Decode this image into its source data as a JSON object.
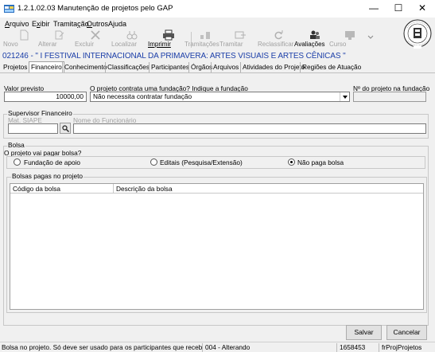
{
  "window": {
    "title": "1.2.1.02.03 Manutenção de projetos pelo GAP",
    "minimize": "—",
    "maximize": "☐",
    "close": "✕"
  },
  "menu": {
    "items": [
      {
        "u": "A",
        "rest": "rquivo"
      },
      {
        "u": "",
        "pre": "E",
        "u2": "x",
        "rest": "ibir"
      },
      {
        "u": "",
        "pre": "Tramita",
        "u2": "ç",
        "rest": "ão"
      },
      {
        "u": "O",
        "rest": "utros"
      },
      {
        "u": "",
        "pre": "A",
        "u2": "j",
        "rest": "uda"
      }
    ]
  },
  "toolbar": {
    "buttons": [
      {
        "label": "Novo",
        "icon": "new-doc-icon",
        "enabled": false
      },
      {
        "label": "Alterar",
        "icon": "edit-doc-icon",
        "enabled": false
      },
      {
        "label": "Excluir",
        "icon": "delete-x-icon",
        "enabled": false
      },
      {
        "label": "Localizar",
        "icon": "binoculars-icon",
        "enabled": false
      },
      {
        "label": "Imprimir",
        "icon": "printer-icon",
        "enabled": true
      },
      {
        "label": "Tramitações",
        "icon": "workflow-icon",
        "enabled": false
      },
      {
        "label": "Tramitar",
        "icon": "send-icon",
        "enabled": false
      },
      {
        "label": "Reclassificar",
        "icon": "refresh-icon",
        "enabled": false
      },
      {
        "label": "Avaliações",
        "icon": "people-icon",
        "enabled": true
      },
      {
        "label": "Curso",
        "icon": "monitor-icon",
        "enabled": false
      }
    ]
  },
  "project_title": "021246 - \" I FESTIVAL INTERNACIONAL DA PRIMAVERA: ARTES VISUAIS E ARTES CÊNICAS \"",
  "tabs": [
    "Projetos",
    "Financeiro",
    "Conhecimento",
    "Classificações",
    "Participantes",
    "Órgãos",
    "Arquivos",
    "Atividades do Projeto",
    "Regiões de Atuação"
  ],
  "active_tab": "Financeiro",
  "financeiro": {
    "valor_previsto_label": "Valor previsto",
    "valor_previsto": "10000,00",
    "fundacao_label": "O projeto contrata uma fundação? Indique a fundação",
    "fundacao_value": "Não necessita contratar fundação",
    "n_projeto_fundacao_label": "Nº do projeto na fundação",
    "n_projeto_fundacao_value": "",
    "supervisor_group": "Supervisor Financeiro",
    "mat_siape_label": "Mat. SIAPE",
    "mat_siape_value": "",
    "nome_funcionario_label": "Nome do Funcionário",
    "nome_funcionario_value": "",
    "bolsa_group": "Bolsa",
    "bolsa_question": "O projeto vai pagar bolsa?",
    "bolsa_options": [
      "Fundação de apoio",
      "Editais (Pesquisa/Extensão)",
      "Não paga bolsa"
    ],
    "bolsa_selected": "Não paga bolsa",
    "bolsas_pagas_group": "Bolsas pagas no projeto",
    "grid_columns": [
      "Código da bolsa",
      "Descrição da bolsa"
    ]
  },
  "buttons": {
    "salvar": "Salvar",
    "cancelar": "Cancelar"
  },
  "statusbar": {
    "hint": "Bolsa no projeto. Só deve ser usado para os participantes que recebem",
    "mode": "004 - Alterando",
    "user_id": "1658453",
    "form": "frProjProjetos"
  }
}
